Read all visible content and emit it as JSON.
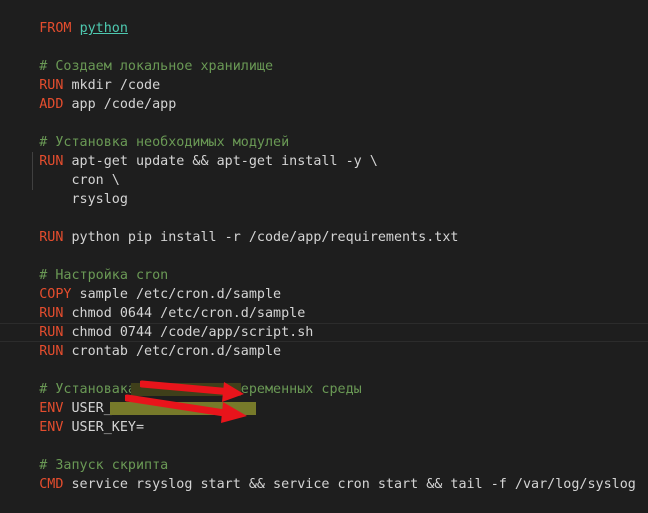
{
  "editor": {
    "lines": [
      {
        "kw": "FROM",
        "rest": " ",
        "img": "python"
      },
      {
        "cm": "# Создаем локальное хранилище"
      },
      {
        "kw": "RUN",
        "rest": " mkdir /code"
      },
      {
        "kw": "ADD",
        "rest": " app /code/app"
      },
      {
        "cm": "# Установка необходимых модулей"
      },
      {
        "kw": "RUN",
        "rest": " apt-get update && apt-get install -y \\"
      },
      {
        "rest": "    cron \\"
      },
      {
        "rest": "    rsyslog"
      },
      {
        "kw": "RUN",
        "rest": " python pip install -r /code/app/requirements.txt"
      },
      {
        "cm": "# Настройка cron"
      },
      {
        "kw": "COPY",
        "rest": " sample /etc/cron.d/sample"
      },
      {
        "kw": "RUN",
        "rest": " chmod 0644 /etc/cron.d/sample"
      },
      {
        "kw": "RUN",
        "rest": " chmod 0744 /code/app/script.sh"
      },
      {
        "kw": "RUN",
        "rest": " crontab /etc/cron.d/sample"
      },
      {
        "cm": "# Установака постоянных переменных среды"
      },
      {
        "kw": "ENV",
        "rest": " USER_DOMAIN="
      },
      {
        "kw": "ENV",
        "rest": " USER_KEY="
      },
      {
        "cm": "# Запуск скрипта"
      },
      {
        "kw": "CMD",
        "rest": " service rsyslog start && service cron start && tail -f /var/log/syslog"
      }
    ]
  },
  "annotation": {
    "arrow_color": "#e8141b",
    "redaction_color": "#6f721f"
  }
}
